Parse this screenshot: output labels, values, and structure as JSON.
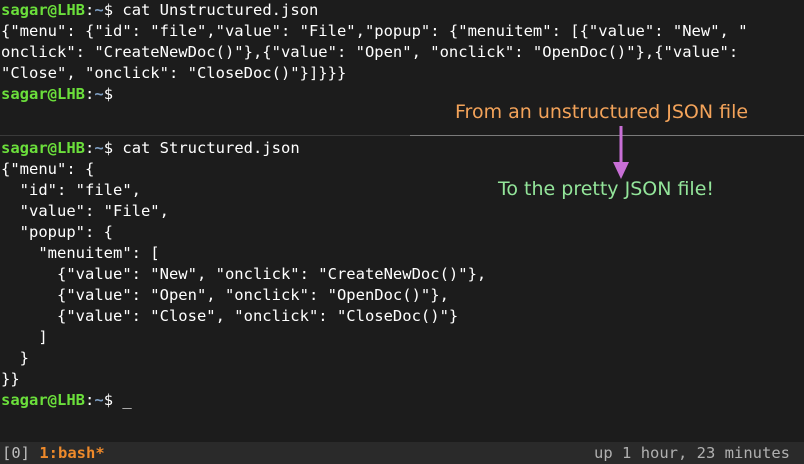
{
  "prompt": {
    "user_host": "sagar@LHB",
    "colon": ":",
    "path": "~",
    "symbol": "$ "
  },
  "top_pane": {
    "command": "cat Unstructured.json",
    "output_lines": [
      "{\"menu\": {\"id\": \"file\",\"value\": \"File\",\"popup\": {\"menuitem\": [{\"value\": \"New\", \"",
      "onclick\": \"CreateNewDoc()\"},{\"value\": \"Open\", \"onclick\": \"OpenDoc()\"},{\"value\":",
      "\"Close\", \"onclick\": \"CloseDoc()\"}]}}}"
    ]
  },
  "bottom_pane": {
    "command": "cat Structured.json",
    "output_lines": [
      "{\"menu\": {",
      "  \"id\": \"file\",",
      "  \"value\": \"File\",",
      "  \"popup\": {",
      "    \"menuitem\": [",
      "      {\"value\": \"New\", \"onclick\": \"CreateNewDoc()\"},",
      "      {\"value\": \"Open\", \"onclick\": \"OpenDoc()\"},",
      "      {\"value\": \"Close\", \"onclick\": \"CloseDoc()\"}",
      "    ]",
      "  }",
      "}}"
    ],
    "cursor": "_"
  },
  "annotations": {
    "top": "From an unstructured JSON file",
    "bottom": "To the pretty JSON file!",
    "arrow_icon": "down-arrow-icon",
    "top_color": "#f3a35a",
    "bottom_color": "#93e59a",
    "arrow_color": "#c86fd6"
  },
  "status_bar": {
    "session": "[0]",
    "window": "1:bash*",
    "uptime": "up 1 hour, 23 minutes"
  }
}
